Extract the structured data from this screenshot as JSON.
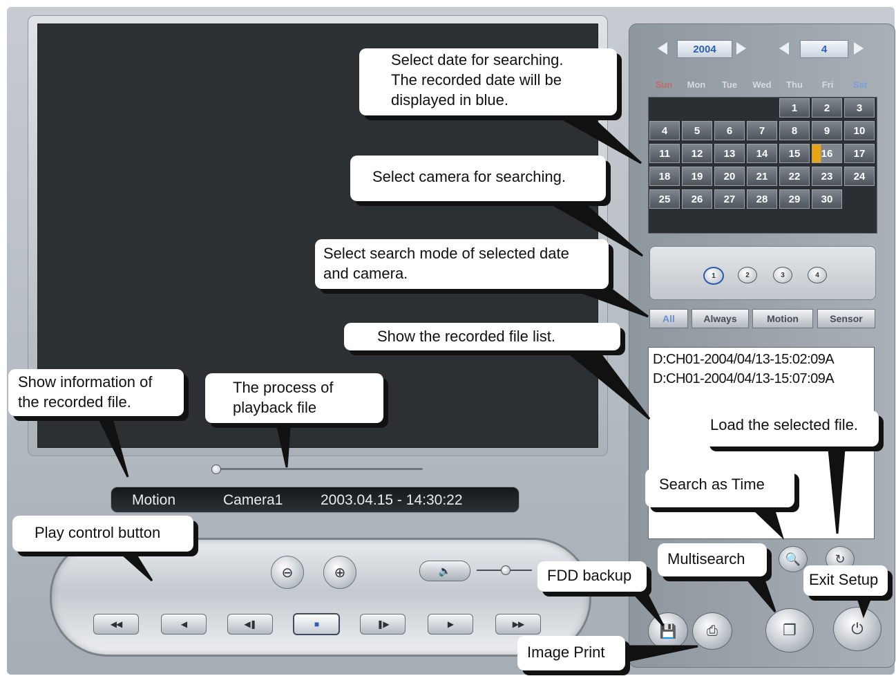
{
  "calendar": {
    "year": "2004",
    "month": "4",
    "weekdays": [
      "Sun",
      "Mon",
      "Tue",
      "Wed",
      "Thu",
      "Fri",
      "Sat"
    ],
    "weekday_colors": {
      "sun": "#c56a6a",
      "sat": "#7a9fd8",
      "weekday": "#d6dbe0"
    },
    "days": [
      "1",
      "2",
      "3",
      "4",
      "5",
      "6",
      "7",
      "8",
      "9",
      "10",
      "11",
      "12",
      "13",
      "14",
      "15",
      "16",
      "17",
      "18",
      "19",
      "20",
      "21",
      "22",
      "23",
      "24",
      "25",
      "26",
      "27",
      "28",
      "29",
      "30"
    ],
    "selected_day": "16"
  },
  "cameras": [
    "1",
    "2",
    "3",
    "4"
  ],
  "search_modes": [
    "All",
    "Always",
    "Motion",
    "Sensor"
  ],
  "files": [
    "D:CH01-2004/04/13-15:02:09A",
    "D:CH01-2004/04/13-15:07:09A"
  ],
  "info_bar": {
    "event": "Motion",
    "camera": "Camera1",
    "datetime": "2003.04.15 - 14:30:22"
  },
  "icons": {
    "zoom_out": "zoom-out-icon",
    "zoom_in": "zoom-in-icon",
    "volume": "speaker-icon",
    "fast_rewind": "fast-rewind-icon",
    "rewind": "rewind-icon",
    "step_back": "step-back-icon",
    "stop": "stop-icon",
    "step_forward": "step-forward-icon",
    "play": "play-icon",
    "fast_forward": "fast-forward-icon",
    "search_time": "search-time-icon",
    "load": "load-icon",
    "fdd_backup": "fdd-backup-icon",
    "image_print": "print-icon",
    "multisearch": "multisearch-icon",
    "exit": "power-icon"
  },
  "callouts": {
    "select_date": [
      "Select date for searching.",
      "The recorded date will be",
      "displayed in blue."
    ],
    "select_camera": "Select camera for searching.",
    "search_mode": [
      "Select search mode of selected date",
      "and camera."
    ],
    "file_list": "Show the recorded file list.",
    "show_info": [
      "Show information of",
      "the recorded file."
    ],
    "playback": [
      "The process of",
      "playback file"
    ],
    "load_file": "Load the selected file.",
    "search_time": "Search as Time",
    "play_control": "Play control button",
    "multisearch": "Multisearch",
    "fdd_backup": "FDD backup",
    "exit_setup": "Exit Setup",
    "image_print": "Image Print"
  },
  "colors": {
    "accent_blue": "#2d5fb0",
    "selected_day": "#e8a417",
    "viewer_bg": "#2d3033"
  }
}
